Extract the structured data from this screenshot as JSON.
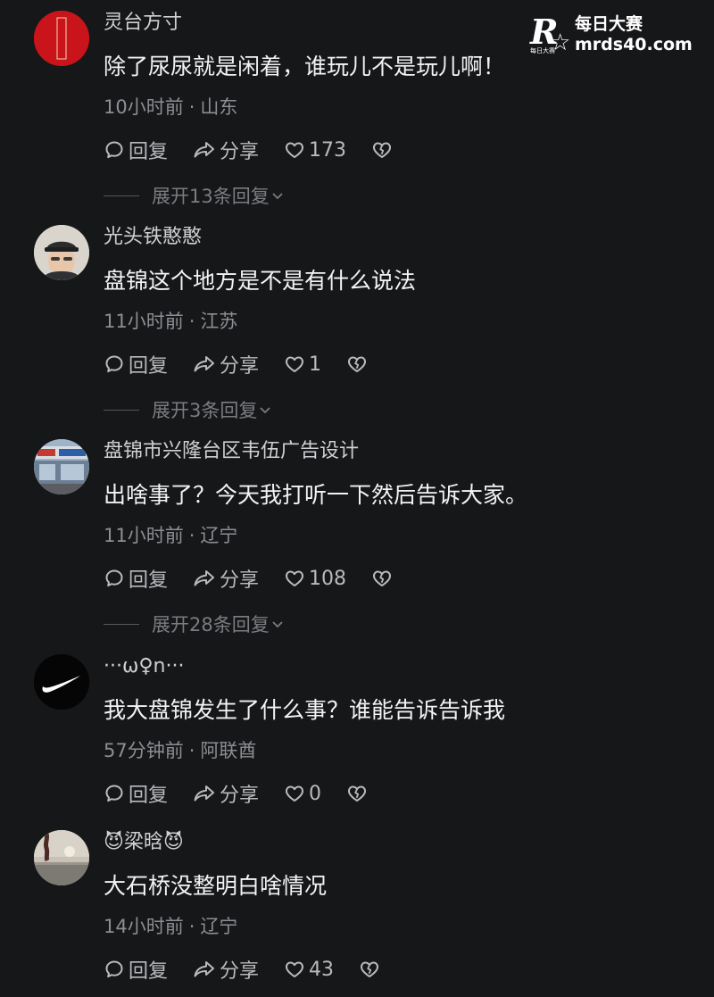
{
  "watermark": {
    "logo_letter": "R",
    "logo_small": "每日大赛",
    "brand_cn": "每日大赛",
    "url": "mrds40.com"
  },
  "labels": {
    "reply": "回复",
    "share": "分享"
  },
  "comments": [
    {
      "username": "灵台方寸",
      "text": "除了尿尿就是闲着，谁玩儿不是玩儿啊！",
      "time": "10小时前",
      "location": "山东",
      "likes": "173",
      "expand": "展开13条回复",
      "avatar": "red-seal-avatar",
      "avatar_seal_text": "晴雲書法"
    },
    {
      "username": "光头铁憨憨",
      "text": "盘锦这个地方是不是有什么说法",
      "time": "11小时前",
      "location": "江苏",
      "likes": "1",
      "expand": "展开3条回复",
      "avatar": "person-cap-avatar"
    },
    {
      "username": "盘锦市兴隆台区韦伍广告设计",
      "text": "出啥事了？今天我打听一下然后告诉大家。",
      "time": "11小时前",
      "location": "辽宁",
      "likes": "108",
      "expand": "展开28条回复",
      "avatar": "storefront-avatar"
    },
    {
      "username": "···ω♀n···",
      "text": "我大盘锦发生了什么事？谁能告诉告诉我",
      "time": "57分钟前",
      "location": "阿联酋",
      "likes": "0",
      "expand": "",
      "avatar": "swoosh-avatar"
    },
    {
      "username": "😈梁晗😈",
      "text": "大石桥没整明白啥情况",
      "time": "14小时前",
      "location": "辽宁",
      "likes": "43",
      "expand": "",
      "avatar": "landscape-avatar"
    }
  ]
}
